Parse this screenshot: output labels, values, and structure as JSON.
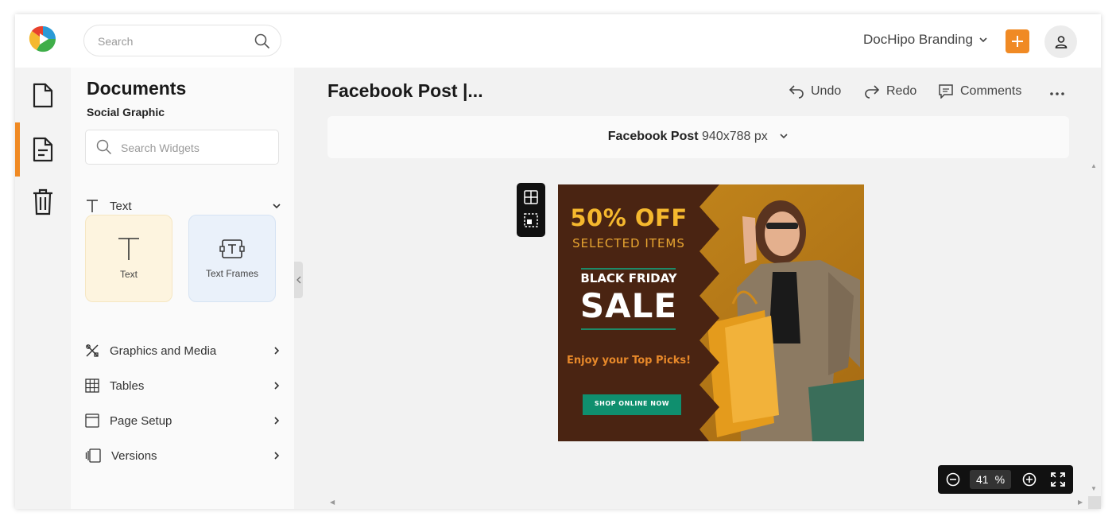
{
  "header": {
    "search_placeholder": "Search",
    "brand_label": "DocHipo Branding"
  },
  "panel": {
    "title": "Documents",
    "subtitle": "Social Graphic",
    "widget_search_placeholder": "Search Widgets",
    "text_section": "Text",
    "tiles": [
      {
        "label": "Text"
      },
      {
        "label": "Text Frames"
      }
    ],
    "sections": [
      {
        "label": "Graphics and Media"
      },
      {
        "label": "Tables"
      },
      {
        "label": "Page Setup"
      },
      {
        "label": "Versions"
      }
    ]
  },
  "document": {
    "title": "Facebook Post |...",
    "undo": "Undo",
    "redo": "Redo",
    "comments": "Comments",
    "size_name": "Facebook Post",
    "size_dims": "940x788 px"
  },
  "design": {
    "offer": "50% OFF",
    "offer_sub": "SELECTED ITEMS",
    "event": "BLACK FRIDAY",
    "sale": "SALE",
    "tagline": "Enjoy your Top Picks!",
    "cta": "SHOP ONLINE NOW"
  },
  "zoom": {
    "value": "41",
    "unit": "%"
  },
  "colors": {
    "accent": "#f08a24",
    "design_brown": "#4a2412",
    "design_gold": "#f5b82e",
    "design_orange": "#e8892a",
    "cta_green": "#0f8f6e",
    "backdrop": "#b87a18"
  }
}
